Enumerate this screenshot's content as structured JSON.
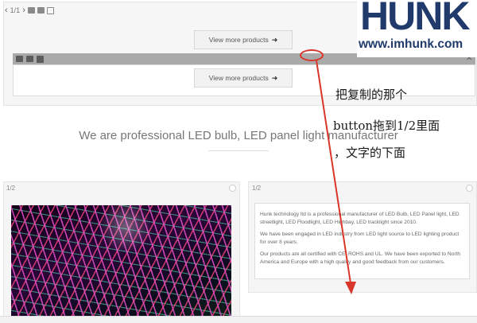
{
  "toolbar": {
    "counter": "1/1"
  },
  "buttons": {
    "view_more_1": "View more products",
    "view_more_2": "View more products"
  },
  "logo": {
    "word": "HUNK",
    "url": "www.imhunk.com"
  },
  "close_glyph": "✕",
  "headline": "We are professional LED bulb, LED panel light manufacturer",
  "annotation": {
    "line1": "把复制的那个",
    "line2": "button拖到1/2里面",
    "line3": "，文字的下面"
  },
  "panels": {
    "left_label": "1/2",
    "right_label": "1/2",
    "paragraphs": [
      "Hunk technology ltd is a professional manufacturer of LED Bulb, LED Panel light, LED streetlight, LED Floodlight, LED Highbay, LED tracklight since 2010.",
      "We have been engaged in LED industry from LED light source to LED lighting product for over 8 years.",
      "Our products are all certified with CE, ROHS and UL. We have been exported to North America and Europe with a high quality and good feedback from our customers."
    ]
  },
  "colors": {
    "annotation_red": "#d9362b",
    "logo_blue": "#1f3a6b",
    "gray_bar": "#a9a9a9"
  },
  "icons": [
    "chevron-left-icon",
    "chevron-right-icon",
    "camera-icon",
    "copy-icon",
    "edit-icon",
    "arrow-right-icon",
    "close-icon"
  ]
}
